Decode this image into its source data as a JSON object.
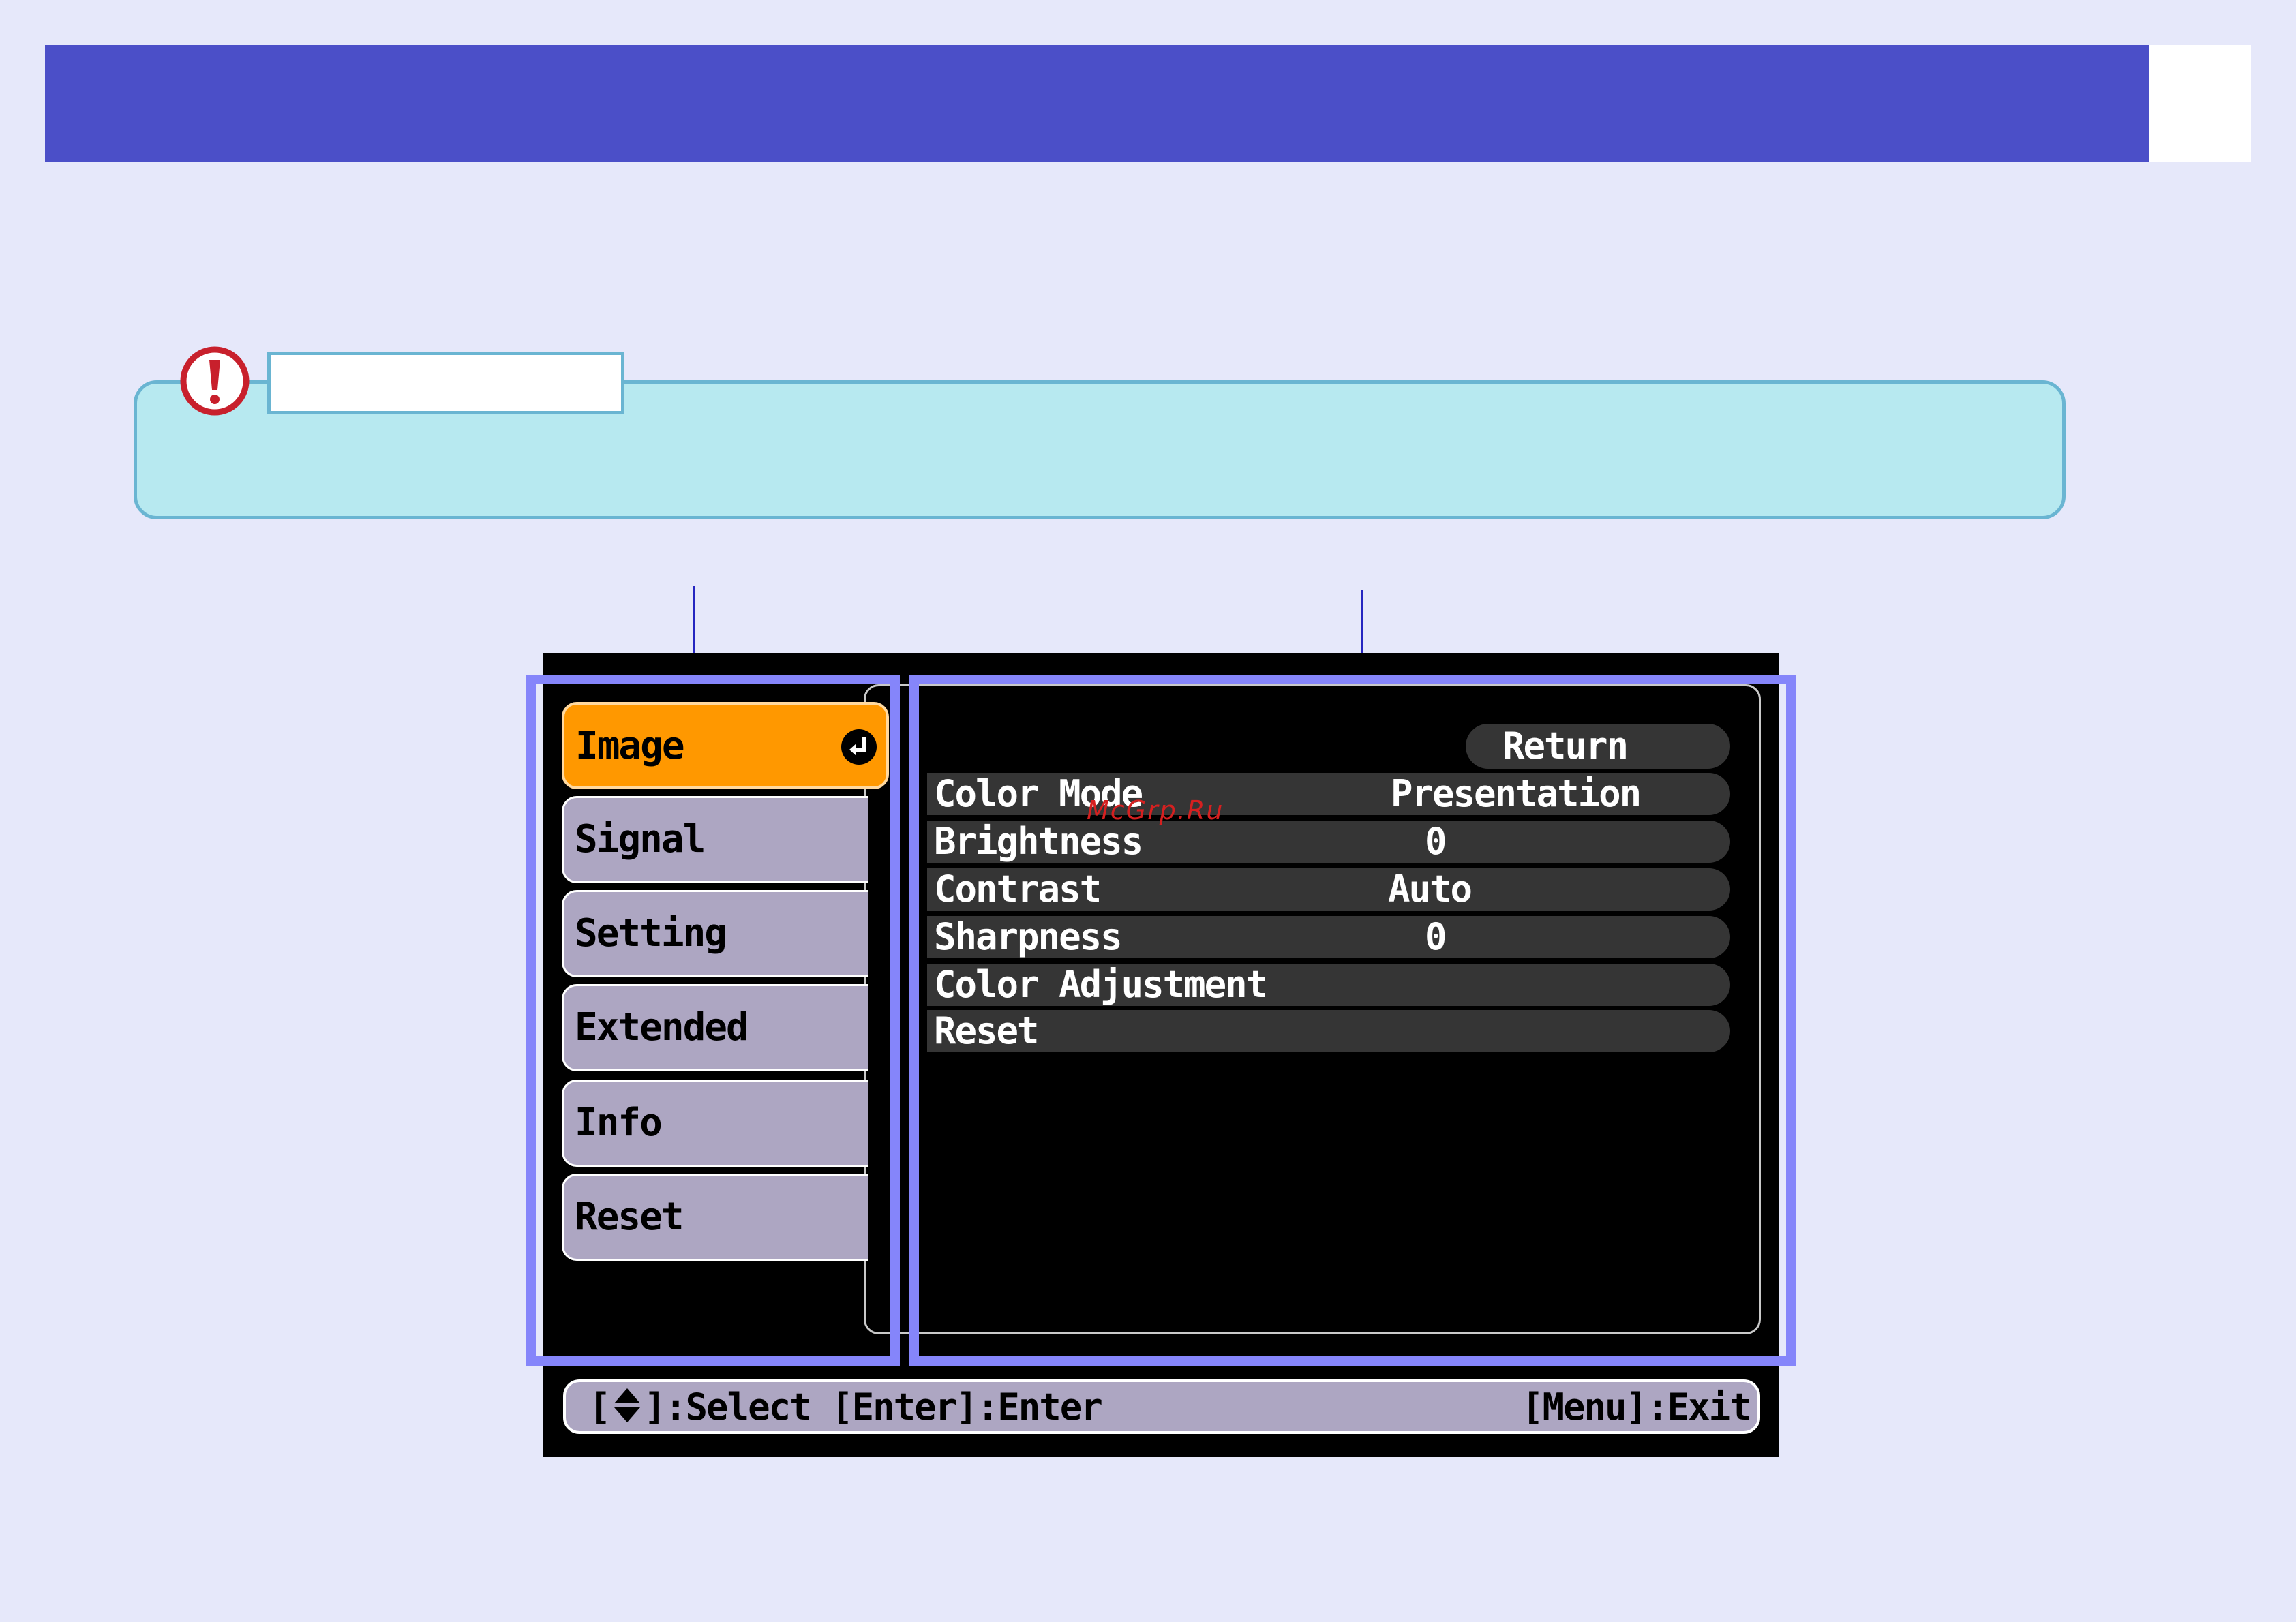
{
  "header": {
    "accent_color": "#4b4fc8"
  },
  "note": {
    "icon": "exclamation-icon",
    "icon_color": "#c8202c"
  },
  "osd": {
    "menu_items": [
      {
        "label": "Image",
        "selected": true
      },
      {
        "label": "Signal",
        "selected": false
      },
      {
        "label": "Setting",
        "selected": false
      },
      {
        "label": "Extended",
        "selected": false
      },
      {
        "label": "Info",
        "selected": false
      },
      {
        "label": "Reset",
        "selected": false
      }
    ],
    "selected_color": "#ff9800",
    "enter_icon": "enter-return-icon",
    "return_label": "Return",
    "settings": [
      {
        "label": "Color Mode",
        "value": "Presentation"
      },
      {
        "label": "Brightness",
        "value": "0"
      },
      {
        "label": "Contrast",
        "value": "Auto"
      },
      {
        "label": "Sharpness",
        "value": "0"
      },
      {
        "label": "Color Adjustment",
        "value": ""
      },
      {
        "label": "Reset",
        "value": ""
      }
    ],
    "status_bar": {
      "left_prefix": "[",
      "left_icon": "up-down-arrows-icon",
      "left_suffix": "]:Select [Enter]:Enter",
      "right": "[Menu]:Exit"
    }
  },
  "watermark": "McGrp.Ru",
  "highlight_color": "#8585fa"
}
